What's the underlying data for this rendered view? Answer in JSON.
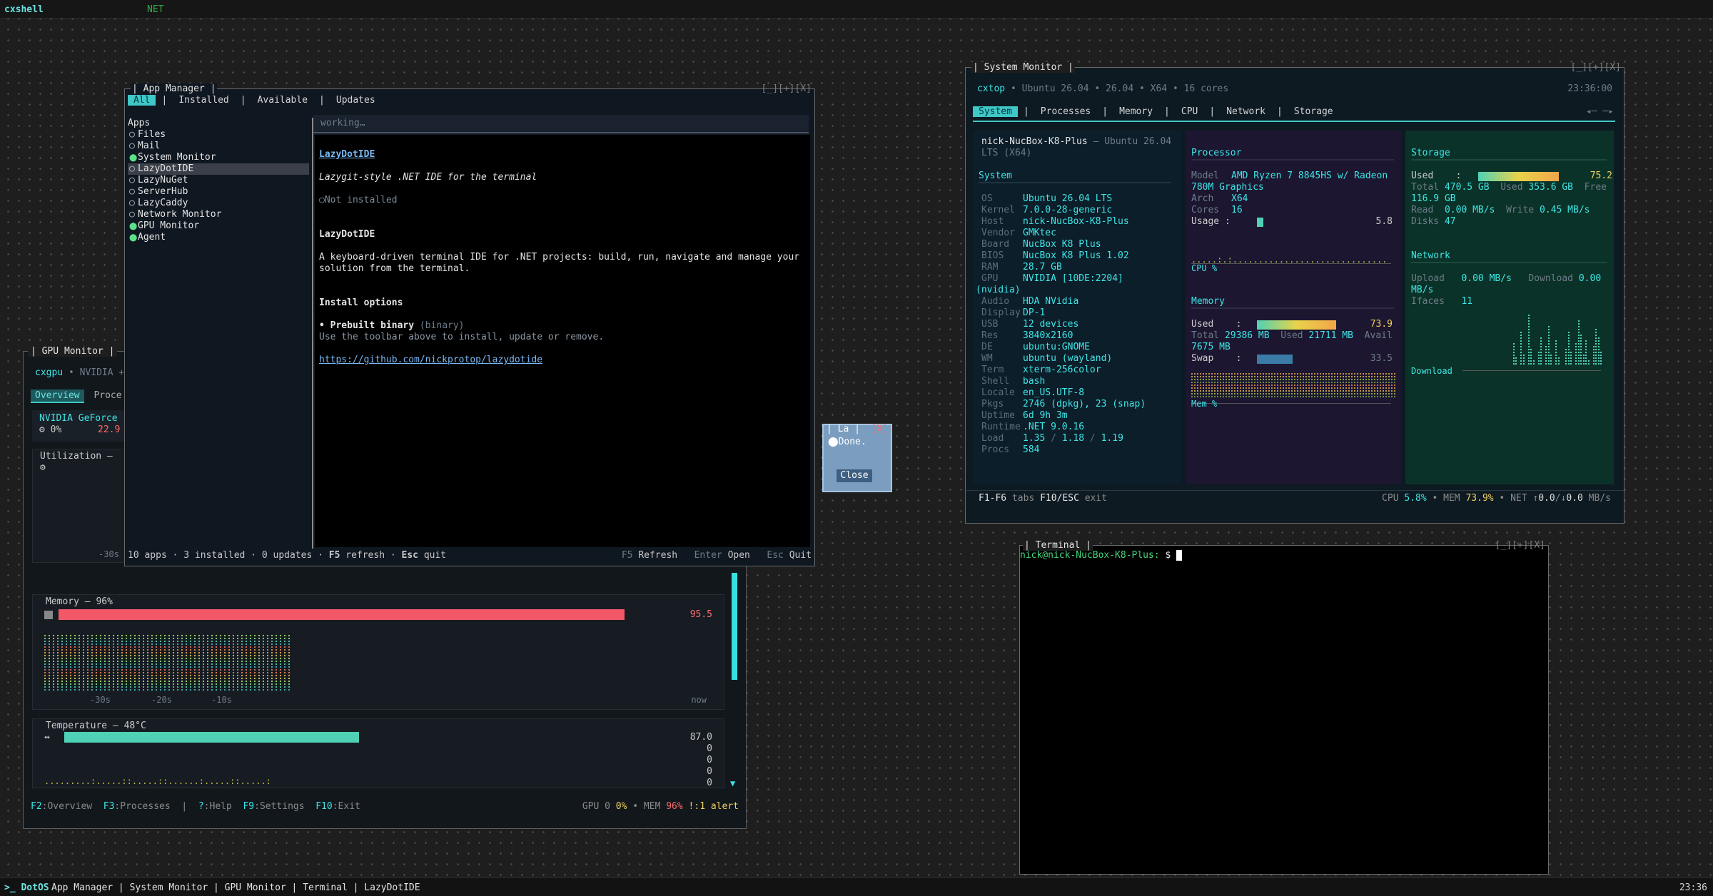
{
  "topbar": {
    "title": "cxshell",
    "net": "NET"
  },
  "taskbar": {
    "brand": ">_ DotOS",
    "items": "App Manager | System Monitor | GPU Monitor | Terminal | LazyDotIDE",
    "clock": "23:36"
  },
  "app_manager": {
    "title": "App Manager",
    "controls": "[_][+][X]",
    "tabs": [
      "All",
      "Installed",
      "Available",
      "Updates"
    ],
    "status_text": "working…",
    "list_header": "Apps",
    "apps": [
      {
        "name": "Files",
        "installed": false
      },
      {
        "name": "Mail",
        "installed": false
      },
      {
        "name": "System Monitor",
        "installed": true
      },
      {
        "name": "LazyDotIDE",
        "installed": false,
        "selected": true
      },
      {
        "name": "LazyNuGet",
        "installed": false
      },
      {
        "name": "ServerHub",
        "installed": false
      },
      {
        "name": "LazyCaddy",
        "installed": false
      },
      {
        "name": "Network Monitor",
        "installed": false
      },
      {
        "name": "GPU Monitor",
        "installed": true
      },
      {
        "name": "Agent",
        "installed": true
      }
    ],
    "detail": {
      "link_title": "LazyDotIDE",
      "tagline": "Lazygit-style .NET IDE for the terminal",
      "install_state": "Not installed",
      "heading": "LazyDotIDE",
      "description": "A keyboard-driven terminal IDE for .NET projects: build, run, navigate and manage your solution from the terminal.",
      "options_heading": "Install options",
      "option_name": "• Prebuilt binary",
      "option_type": "(binary)",
      "option_hint": "Use the toolbar above to install, update or remove.",
      "url": "https://github.com/nickprotop/lazydotide"
    },
    "footer_left_1": "10 apps · 3 installed · 0 updates · ",
    "footer_left_key1": "F5",
    "footer_left_2": " refresh · ",
    "footer_left_key2": "Esc",
    "footer_left_3": " quit",
    "footer_right": [
      {
        "key": "F5",
        "label": "Refresh"
      },
      {
        "key": "Enter",
        "label": "Open"
      },
      {
        "key": "Esc",
        "label": "Quit"
      }
    ]
  },
  "dialog": {
    "title": "La",
    "close": "[X]",
    "message": "Done.",
    "button": "Close"
  },
  "gpu_monitor": {
    "title": "GPU Monitor",
    "header_name": "cxgpu",
    "header_sub": "• NVIDIA +",
    "tabs": [
      "Overview",
      "Proce"
    ],
    "gpu_name": "NVIDIA GeForce",
    "gpu_stat1": "⚙ 0%",
    "gpu_stat2": "22.9",
    "util_label": "Utilization –",
    "util_icon": "⚙",
    "util_axis": "-30s",
    "memory_label": "Memory – 96%",
    "memory_value": "95.5",
    "memory_fraction": 0.955,
    "memory_axis": [
      "-30s",
      "-20s",
      "-10s",
      "now"
    ],
    "temp_label": "Temperature – 48°C",
    "temp_icon": "↭",
    "temp_value": "87.0",
    "temp_fraction": 0.48,
    "temp_extra": [
      "0",
      "0",
      "0",
      "0"
    ],
    "footer": [
      {
        "key": "F2",
        "label": ":Overview"
      },
      {
        "key": "F3",
        "label": ":Processes"
      },
      {
        "key": "|",
        "label": ""
      },
      {
        "key": "?",
        "label": ":Help"
      },
      {
        "key": "F9",
        "label": ":Settings"
      },
      {
        "key": "F10",
        "label": ":Exit"
      }
    ],
    "footer_right_1": "GPU 0 ",
    "footer_right_gpu": "0%",
    "footer_right_2": " • MEM ",
    "footer_right_mem": "96%",
    "footer_right_3": " ",
    "footer_right_alert": "!:1 alert"
  },
  "system_monitor": {
    "title": "System Monitor",
    "controls": "[_][+][X]",
    "header_app": "cxtop",
    "header_sub": "• Ubuntu 26.04 • 26.04 • X64 • 16 cores",
    "header_clock": "23:36:00",
    "tabs": [
      "System",
      "Processes",
      "Memory",
      "CPU",
      "Network",
      "Storage"
    ],
    "arrows": "◂─ ─▸",
    "host_line": "nick-NucBox-K8-Plus",
    "host_sub": "– Ubuntu 26.04 LTS (X64)",
    "system_heading": "System",
    "system_info": [
      [
        "OS",
        "Ubuntu 26.04 LTS"
      ],
      [
        "Kernel",
        "7.0.0-28-generic"
      ],
      [
        "Host",
        "nick-NucBox-K8-Plus"
      ],
      [
        "Vendor",
        "GMKtec"
      ],
      [
        "Board",
        "NucBox K8 Plus"
      ],
      [
        "BIOS",
        "NucBox K8 Plus 1.02"
      ],
      [
        "RAM",
        "28.7 GB"
      ],
      [
        "GPU",
        "NVIDIA [10DE:2204]"
      ],
      [
        "",
        "(nvidia)"
      ],
      [
        "Audio",
        "HDA NVidia"
      ],
      [
        "Display",
        "DP-1"
      ],
      [
        "USB",
        "12 devices"
      ],
      [
        "Res",
        "3840x2160"
      ],
      [
        "DE",
        "ubuntu:GNOME"
      ],
      [
        "WM",
        "ubuntu (wayland)"
      ],
      [
        "Term",
        "xterm-256color"
      ],
      [
        "Shell",
        "bash"
      ],
      [
        "Locale",
        "en_US.UTF-8"
      ],
      [
        "Pkgs",
        "2746 (dpkg), 23 (snap)"
      ],
      [
        "Uptime",
        "6d 9h 3m"
      ],
      [
        "Runtime",
        ".NET 9.0.16"
      ],
      [
        "Load",
        "1.35 / 1.18 / 1.19"
      ],
      [
        "Procs",
        "584"
      ]
    ],
    "processor_heading": "Processor",
    "cpu_model_label": "Model",
    "cpu_model": "AMD Ryzen 7 8845HS w/ Radeon 780M Graphics",
    "cpu_arch_label": "Arch",
    "cpu_arch": "X64",
    "cpu_cores_label": "Cores",
    "cpu_cores": "16",
    "cpu_usage_label": "Usage",
    "cpu_usage": "5.8",
    "cpu_usage_fraction": 0.058,
    "cpu_graph_label": "CPU %",
    "memory_heading": "Memory",
    "mem_used_label": "Used",
    "mem_used": "73.9",
    "mem_used_fraction": 0.739,
    "mem_total_label": "Total",
    "mem_total": "29386 MB",
    "mem_used2_label": "Used",
    "mem_used2": "21711 MB",
    "mem_avail_label": "Avail",
    "mem_avail": "7675 MB",
    "swap_label": "Swap",
    "swap_value": "33.5",
    "swap_fraction": 0.335,
    "mem_graph_label": "Mem %",
    "storage_heading": "Storage",
    "disk_used_label": "Used",
    "disk_used": "75.2",
    "disk_used_fraction": 0.752,
    "disk_total_label": "Total",
    "disk_total": "470.5 GB",
    "disk_used2_label": "Used",
    "disk_used2": "353.6 GB",
    "disk_free_label": "Free",
    "disk_free": "116.9 GB",
    "disk_read_label": "Read",
    "disk_read": "0.00 MB/s",
    "disk_write_label": "Write",
    "disk_write": "0.45 MB/s",
    "disks_label": "Disks",
    "disks": "47",
    "network_heading": "Network",
    "net_upload_label": "Upload",
    "net_upload": "0.00 MB/s",
    "net_download_label": "Download",
    "net_download": "0.00 MB/s",
    "ifaces_label": "Ifaces",
    "ifaces": "11",
    "net_graph_label": "Download",
    "footer_keys": "F1-F6",
    "footer_tabs": "tabs",
    "footer_exit_key": "F10/ESC",
    "footer_exit": "exit",
    "footer_r1": "CPU ",
    "footer_cpu": "5.8%",
    "footer_r2": " • MEM ",
    "footer_mem": "73.9%",
    "footer_r3": " • NET ↑",
    "footer_up": "0.0",
    "footer_r4": "/↓",
    "footer_down": "0.0",
    "footer_r5": " MB/s"
  },
  "terminal": {
    "title": "Terminal",
    "controls": "[_][+][X]",
    "prompt": "nick@nick-NucBox-K8-Plus:",
    "prompt_symbol": "$"
  },
  "colors": {
    "accent": "#3ec8c8",
    "memory_bar": "#f25868",
    "temp_bar": "#4fd1b5"
  }
}
